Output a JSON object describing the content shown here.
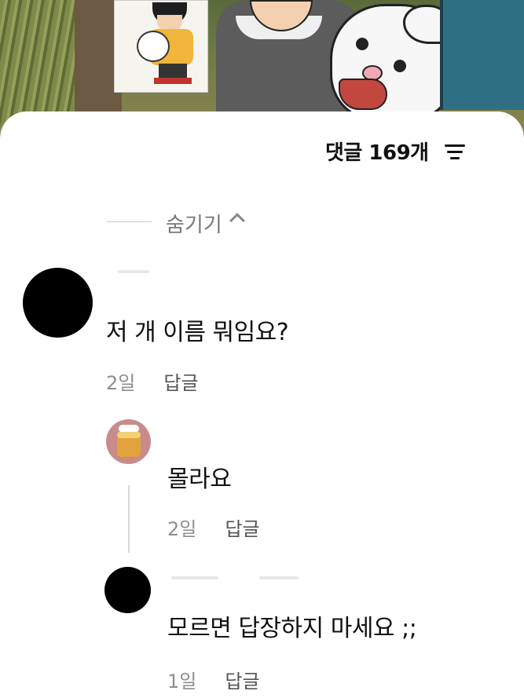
{
  "header": {
    "comment_count_label": "댓글 169개"
  },
  "thread": {
    "hide_label": "숨기기"
  },
  "comments": [
    {
      "text": "저 개 이름 뭐임요?",
      "time": "2일",
      "reply_label": "답글"
    }
  ],
  "replies": [
    {
      "text": "몰라요",
      "time": "2일",
      "reply_label": "답글"
    },
    {
      "text": "모르면 답장하지 마세요 ;;",
      "time": "1일",
      "reply_label": "답글"
    }
  ],
  "icons": {
    "sort": "sort-lines-icon",
    "collapse": "chevron-up-icon"
  },
  "colors": {
    "sheet_background": "#ffffff",
    "primary_text": "#111111",
    "secondary_text": "#8e8e8e"
  }
}
